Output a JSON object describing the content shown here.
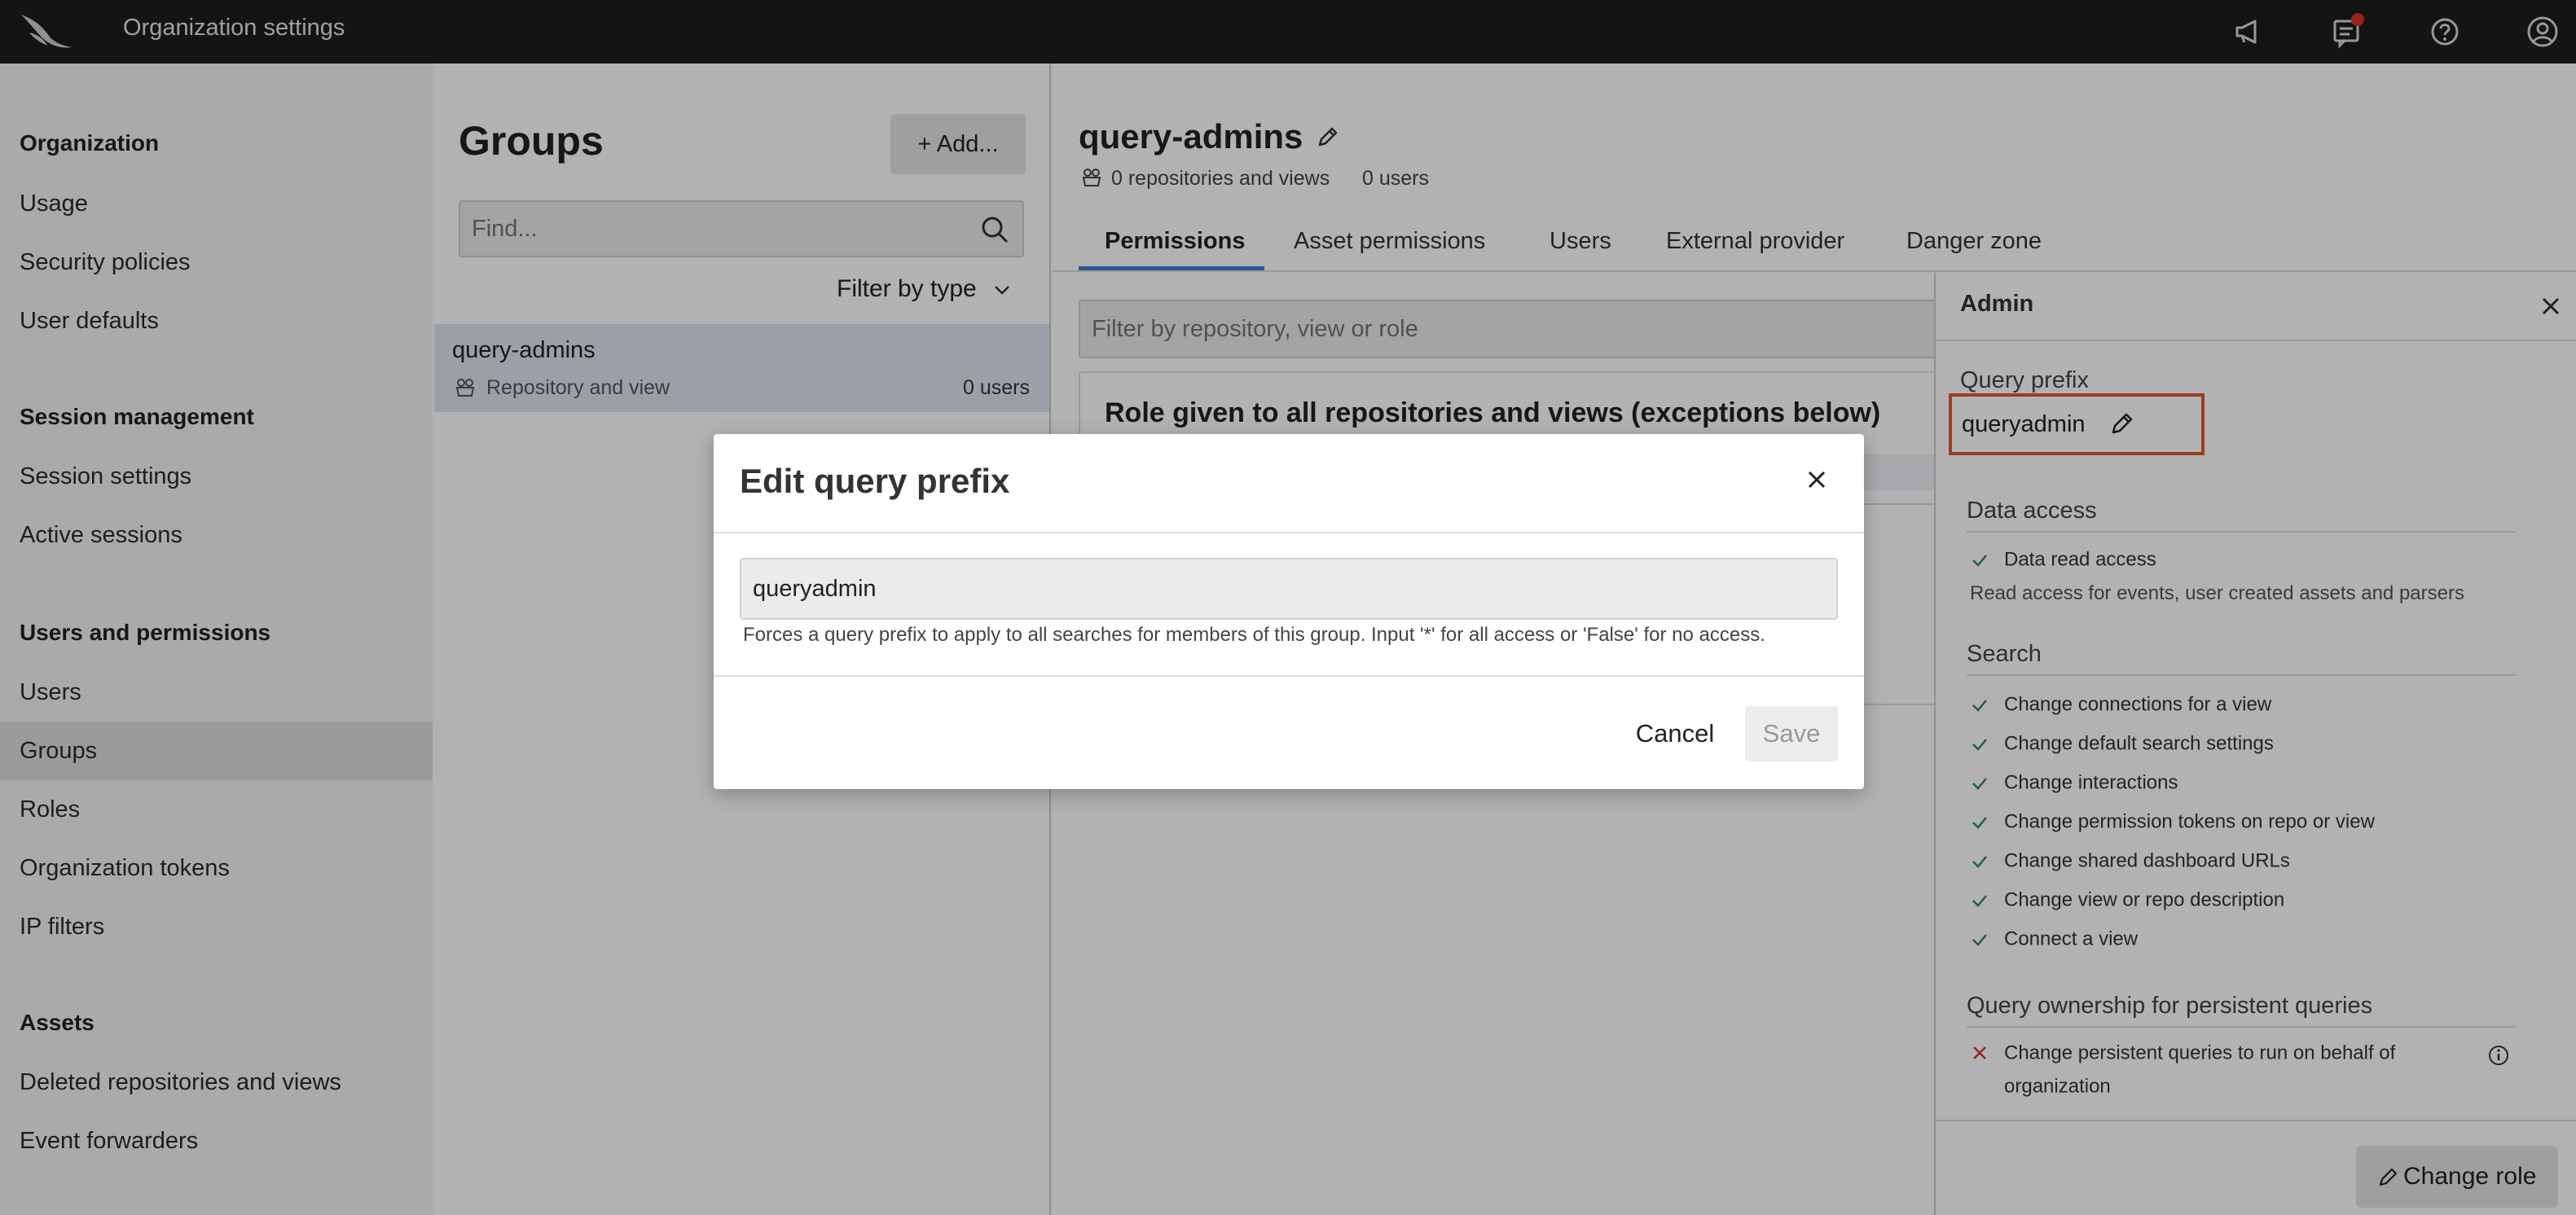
{
  "topbar": {
    "app_title": "Organization settings",
    "icons": [
      "logo-icon",
      "megaphone-icon",
      "notifications-icon",
      "help-icon",
      "account-icon"
    ],
    "notification_dot_color": "#d9342b"
  },
  "sidebar": {
    "sections": [
      {
        "title": "Organization",
        "items": [
          "Usage",
          "Security policies",
          "User defaults"
        ]
      },
      {
        "title": "Session management",
        "items": [
          "Session settings",
          "Active sessions"
        ]
      },
      {
        "title": "Users and permissions",
        "items": [
          "Users",
          "Groups",
          "Roles",
          "Organization tokens",
          "IP filters"
        ]
      },
      {
        "title": "Assets",
        "items": [
          "Deleted repositories and views",
          "Event forwarders"
        ]
      }
    ],
    "active_item": "Groups"
  },
  "groups": {
    "title": "Groups",
    "add_label": "+ Add...",
    "search_placeholder": "Find...",
    "filter_label": "Filter by type",
    "rows": [
      {
        "name": "query-admins",
        "type": "Repository and view",
        "count": "0 users"
      }
    ]
  },
  "main": {
    "title": "query-admins",
    "repos_meta": "0 repositories and views",
    "users_meta": "0 users",
    "tabs": [
      "Permissions",
      "Asset permissions",
      "Users",
      "External provider",
      "Danger zone"
    ],
    "active_tab": "Permissions",
    "filter_placeholder": "Filter by repository, view or role",
    "role_card_title": "Role given to all repositories and views (exceptions below)",
    "accent_color": "#3a7bd5"
  },
  "panel": {
    "title": "Admin",
    "query_prefix_label": "Query prefix",
    "query_prefix_value": "queryadmin",
    "highlight_color": "#e2552f",
    "sections": {
      "data_access": {
        "title": "Data access",
        "items": [
          "Data read access"
        ],
        "description": "Read access for events, user created assets and parsers"
      },
      "search": {
        "title": "Search",
        "items": [
          "Change connections for a view",
          "Change default search settings",
          "Change interactions",
          "Change permission tokens on repo or view",
          "Change shared dashboard URLs",
          "Change view or repo description",
          "Connect a view"
        ]
      },
      "ownership": {
        "title": "Query ownership for persistent queries",
        "items": [
          "Change persistent queries to run on behalf of organization"
        ]
      }
    },
    "change_role_label": "Change role",
    "check_color": "#2e8b57",
    "cross_color": "#d9342b"
  },
  "modal": {
    "title": "Edit query prefix",
    "input_value": "queryadmin",
    "help_text": "Forces a query prefix to apply to all searches for members of this group. Input '*' for all access or 'False' for no access.",
    "cancel_label": "Cancel",
    "save_label": "Save"
  }
}
